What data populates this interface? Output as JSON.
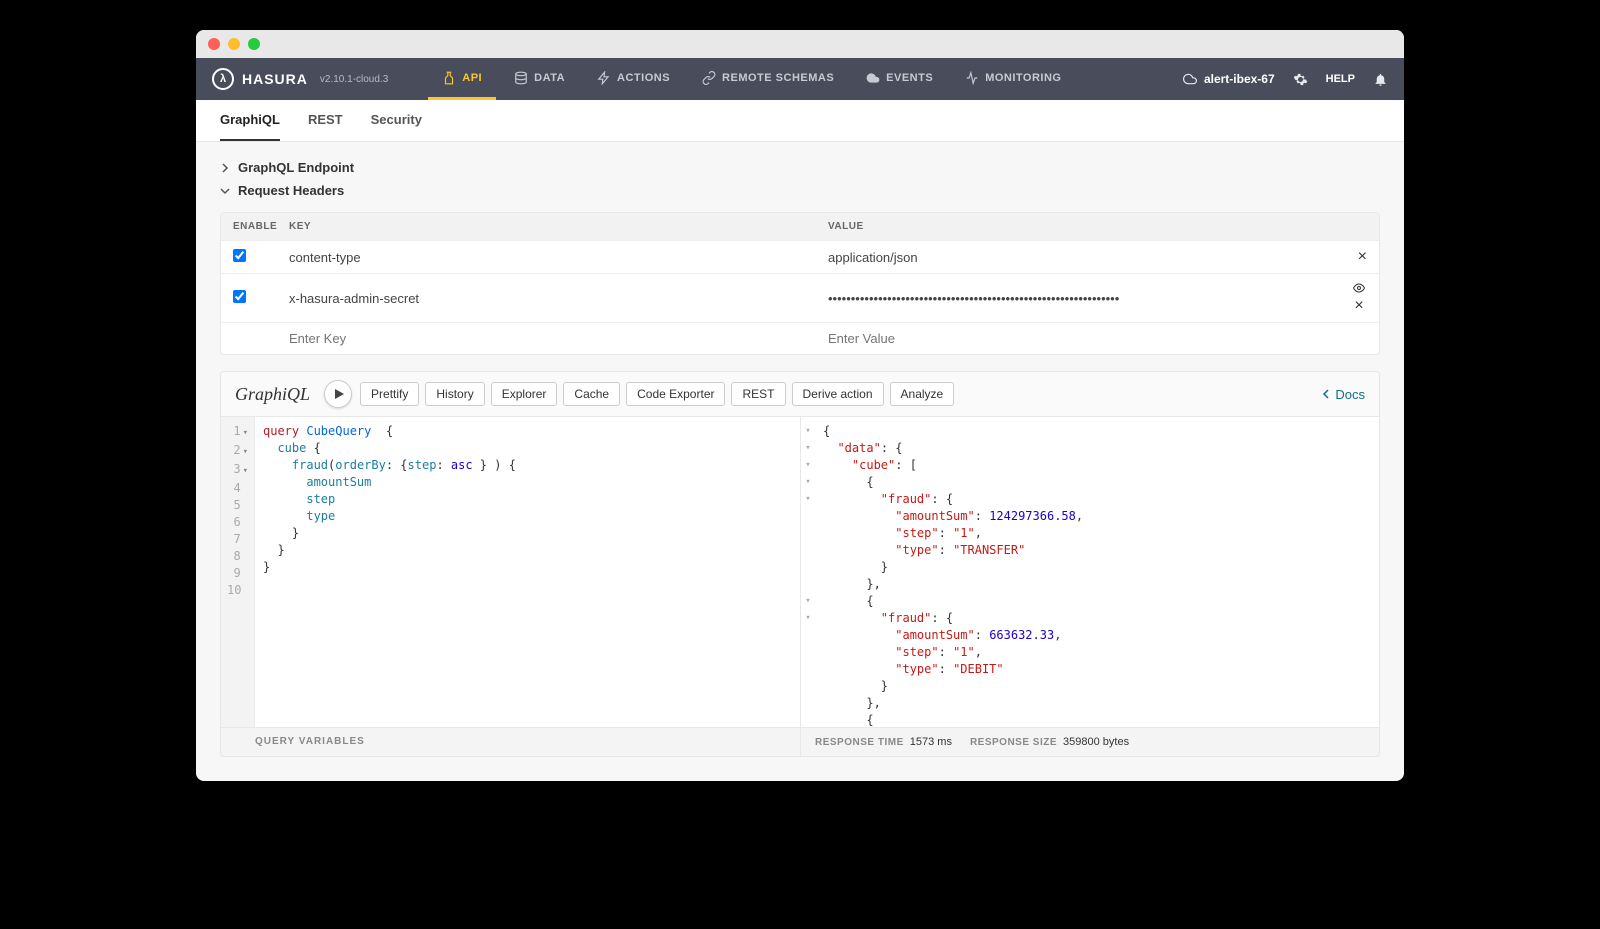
{
  "brand": {
    "name": "HASURA",
    "version": "v2.10.1-cloud.3"
  },
  "topnav": {
    "items": [
      {
        "label": "API",
        "active": true
      },
      {
        "label": "DATA"
      },
      {
        "label": "ACTIONS"
      },
      {
        "label": "REMOTE SCHEMAS"
      },
      {
        "label": "EVENTS"
      },
      {
        "label": "MONITORING"
      }
    ],
    "project": "alert-ibex-67",
    "help": "HELP"
  },
  "subnav": {
    "items": [
      {
        "label": "GraphiQL",
        "active": true
      },
      {
        "label": "REST"
      },
      {
        "label": "Security"
      }
    ]
  },
  "sections": {
    "endpoint": "GraphQL Endpoint",
    "headers": "Request Headers"
  },
  "headersTable": {
    "cols": {
      "enable": "ENABLE",
      "key": "KEY",
      "value": "VALUE"
    },
    "rows": [
      {
        "enabled": true,
        "key": "content-type",
        "value": "application/json",
        "masked": false
      },
      {
        "enabled": true,
        "key": "x-hasura-admin-secret",
        "value": "••••••••••••••••••••••••••••••••••••••••••••••••••••••••••••••••",
        "masked": true
      }
    ],
    "placeholders": {
      "key": "Enter Key",
      "value": "Enter Value"
    }
  },
  "graphiql": {
    "logo": "GraphiQL",
    "buttons": [
      "Prettify",
      "History",
      "Explorer",
      "Cache",
      "Code Exporter",
      "REST",
      "Derive action",
      "Analyze"
    ],
    "docs": "Docs",
    "queryVars": "QUERY VARIABLES",
    "query": {
      "lines": [
        {
          "n": 1,
          "fold": true,
          "tokens": [
            [
              "kw",
              "query"
            ],
            [
              "sp",
              " "
            ],
            [
              "def",
              "CubeQuery"
            ],
            [
              "sp",
              "  "
            ],
            [
              "p",
              "{"
            ]
          ]
        },
        {
          "n": 2,
          "fold": true,
          "tokens": [
            [
              "sp",
              "  "
            ],
            [
              "field",
              "cube"
            ],
            [
              "sp",
              " "
            ],
            [
              "p",
              "{"
            ]
          ]
        },
        {
          "n": 3,
          "fold": true,
          "tokens": [
            [
              "sp",
              "    "
            ],
            [
              "field",
              "fraud"
            ],
            [
              "p",
              "("
            ],
            [
              "arg",
              "orderBy"
            ],
            [
              "p",
              ": {"
            ],
            [
              "arg",
              "step"
            ],
            [
              "p",
              ": "
            ],
            [
              "asc",
              "asc"
            ],
            [
              "sp",
              " "
            ],
            [
              "p",
              "} ) {"
            ]
          ]
        },
        {
          "n": 4,
          "tokens": [
            [
              "sp",
              "      "
            ],
            [
              "field",
              "amountSum"
            ]
          ]
        },
        {
          "n": 5,
          "tokens": [
            [
              "sp",
              "      "
            ],
            [
              "field",
              "step"
            ]
          ]
        },
        {
          "n": 6,
          "tokens": [
            [
              "sp",
              "      "
            ],
            [
              "field",
              "type"
            ]
          ]
        },
        {
          "n": 7,
          "tokens": [
            [
              "sp",
              "    "
            ],
            [
              "p",
              "}"
            ]
          ]
        },
        {
          "n": 8,
          "tokens": [
            [
              "sp",
              "  "
            ],
            [
              "p",
              "}"
            ]
          ]
        },
        {
          "n": 9,
          "tokens": [
            [
              "p",
              "}"
            ]
          ]
        },
        {
          "n": 10,
          "tokens": []
        }
      ]
    },
    "result": {
      "lines": [
        {
          "fold": true,
          "tokens": [
            [
              "p",
              "{"
            ]
          ]
        },
        {
          "fold": true,
          "tokens": [
            [
              "sp",
              "  "
            ],
            [
              "key",
              "\"data\""
            ],
            [
              "p",
              ": {"
            ]
          ]
        },
        {
          "fold": true,
          "tokens": [
            [
              "sp",
              "    "
            ],
            [
              "key",
              "\"cube\""
            ],
            [
              "p",
              ": ["
            ]
          ]
        },
        {
          "fold": true,
          "tokens": [
            [
              "sp",
              "      "
            ],
            [
              "p",
              "{"
            ]
          ]
        },
        {
          "fold": true,
          "tokens": [
            [
              "sp",
              "        "
            ],
            [
              "key",
              "\"fraud\""
            ],
            [
              "p",
              ": {"
            ]
          ]
        },
        {
          "tokens": [
            [
              "sp",
              "          "
            ],
            [
              "key",
              "\"amountSum\""
            ],
            [
              "p",
              ": "
            ],
            [
              "num",
              "124297366.58"
            ],
            [
              "p",
              ","
            ]
          ]
        },
        {
          "tokens": [
            [
              "sp",
              "          "
            ],
            [
              "key",
              "\"step\""
            ],
            [
              "p",
              ": "
            ],
            [
              "str",
              "\"1\""
            ],
            [
              "p",
              ","
            ]
          ]
        },
        {
          "tokens": [
            [
              "sp",
              "          "
            ],
            [
              "key",
              "\"type\""
            ],
            [
              "p",
              ": "
            ],
            [
              "str",
              "\"TRANSFER\""
            ]
          ]
        },
        {
          "tokens": [
            [
              "sp",
              "        "
            ],
            [
              "p",
              "}"
            ]
          ]
        },
        {
          "tokens": [
            [
              "sp",
              "      "
            ],
            [
              "p",
              "},"
            ]
          ]
        },
        {
          "fold": true,
          "tokens": [
            [
              "sp",
              "      "
            ],
            [
              "p",
              "{"
            ]
          ]
        },
        {
          "fold": true,
          "tokens": [
            [
              "sp",
              "        "
            ],
            [
              "key",
              "\"fraud\""
            ],
            [
              "p",
              ": {"
            ]
          ]
        },
        {
          "tokens": [
            [
              "sp",
              "          "
            ],
            [
              "key",
              "\"amountSum\""
            ],
            [
              "p",
              ": "
            ],
            [
              "num",
              "663632.33"
            ],
            [
              "p",
              ","
            ]
          ]
        },
        {
          "tokens": [
            [
              "sp",
              "          "
            ],
            [
              "key",
              "\"step\""
            ],
            [
              "p",
              ": "
            ],
            [
              "str",
              "\"1\""
            ],
            [
              "p",
              ","
            ]
          ]
        },
        {
          "tokens": [
            [
              "sp",
              "          "
            ],
            [
              "key",
              "\"type\""
            ],
            [
              "p",
              ": "
            ],
            [
              "str",
              "\"DEBIT\""
            ]
          ]
        },
        {
          "tokens": [
            [
              "sp",
              "        "
            ],
            [
              "p",
              "}"
            ]
          ]
        },
        {
          "tokens": [
            [
              "sp",
              "      "
            ],
            [
              "p",
              "},"
            ]
          ]
        },
        {
          "tokens": [
            [
              "sp",
              "      "
            ],
            [
              "p",
              "{"
            ]
          ]
        }
      ]
    },
    "stats": {
      "timeLabel": "RESPONSE TIME",
      "timeValue": "1573 ms",
      "sizeLabel": "RESPONSE SIZE",
      "sizeValue": "359800 bytes"
    }
  }
}
